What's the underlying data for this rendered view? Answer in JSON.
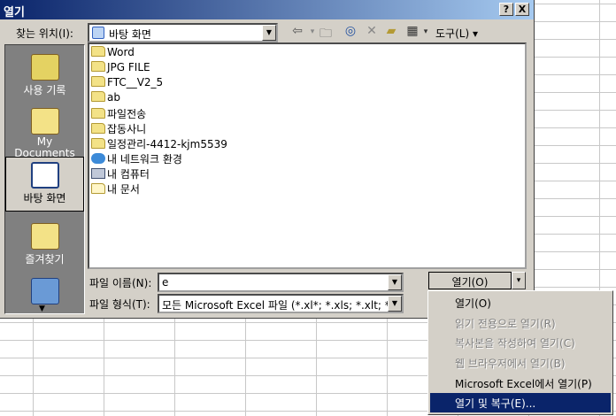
{
  "dialog": {
    "title": "열기",
    "help_button": "?",
    "close_button": "X"
  },
  "lookin": {
    "label": "찾는 위치(I):",
    "value": "바탕 화면"
  },
  "toolbar": {
    "back_icon": "back-arrow-icon",
    "up_icon": "up-folder-icon",
    "search_icon": "search-web-icon",
    "delete_icon": "delete-icon",
    "newfolder_icon": "new-folder-icon",
    "views_icon": "views-icon",
    "tools_label": "도구(L) ▾"
  },
  "places": [
    {
      "label": "사용 기록",
      "icon": "history-icon"
    },
    {
      "label": "My Documents",
      "icon": "my-documents-icon"
    },
    {
      "label": "바탕 화면",
      "icon": "desktop-icon"
    },
    {
      "label": "즐겨찾기",
      "icon": "favorites-icon"
    },
    {
      "label": "",
      "icon": "network-icon"
    }
  ],
  "files": [
    {
      "name": "Word",
      "icon": "folder-icon"
    },
    {
      "name": "JPG FILE",
      "icon": "folder-icon"
    },
    {
      "name": "FTC__V2_5",
      "icon": "folder-icon"
    },
    {
      "name": "ab",
      "icon": "folder-icon"
    },
    {
      "name": "파일전송",
      "icon": "folder-icon"
    },
    {
      "name": "잡동사니",
      "icon": "folder-icon"
    },
    {
      "name": "일정관리-4412-kjm5539",
      "icon": "folder-icon"
    },
    {
      "name": "내 네트워크 환경",
      "icon": "network-places-icon"
    },
    {
      "name": "내 컴퓨터",
      "icon": "my-computer-icon"
    },
    {
      "name": "내 문서",
      "icon": "my-documents-icon"
    }
  ],
  "filename": {
    "label": "파일 이름(N):",
    "value": "e"
  },
  "filetype": {
    "label": "파일 형식(T):",
    "value": "모든 Microsoft Excel 파일 (*.xl*; *.xls; *.xlt; *"
  },
  "open_button": {
    "label": "열기(O)",
    "arrow": "▾"
  },
  "open_menu": [
    {
      "label": "열기(O)",
      "state": "enabled"
    },
    {
      "label": "읽기 전용으로 열기(R)",
      "state": "disabled"
    },
    {
      "label": "복사본을 작성하여 열기(C)",
      "state": "disabled"
    },
    {
      "label": "웹 브라우저에서 열기(B)",
      "state": "disabled"
    },
    {
      "label": "Microsoft Excel에서 열기(P)",
      "state": "enabled"
    },
    {
      "label": "열기 및 복구(E)...",
      "state": "highlighted"
    }
  ]
}
